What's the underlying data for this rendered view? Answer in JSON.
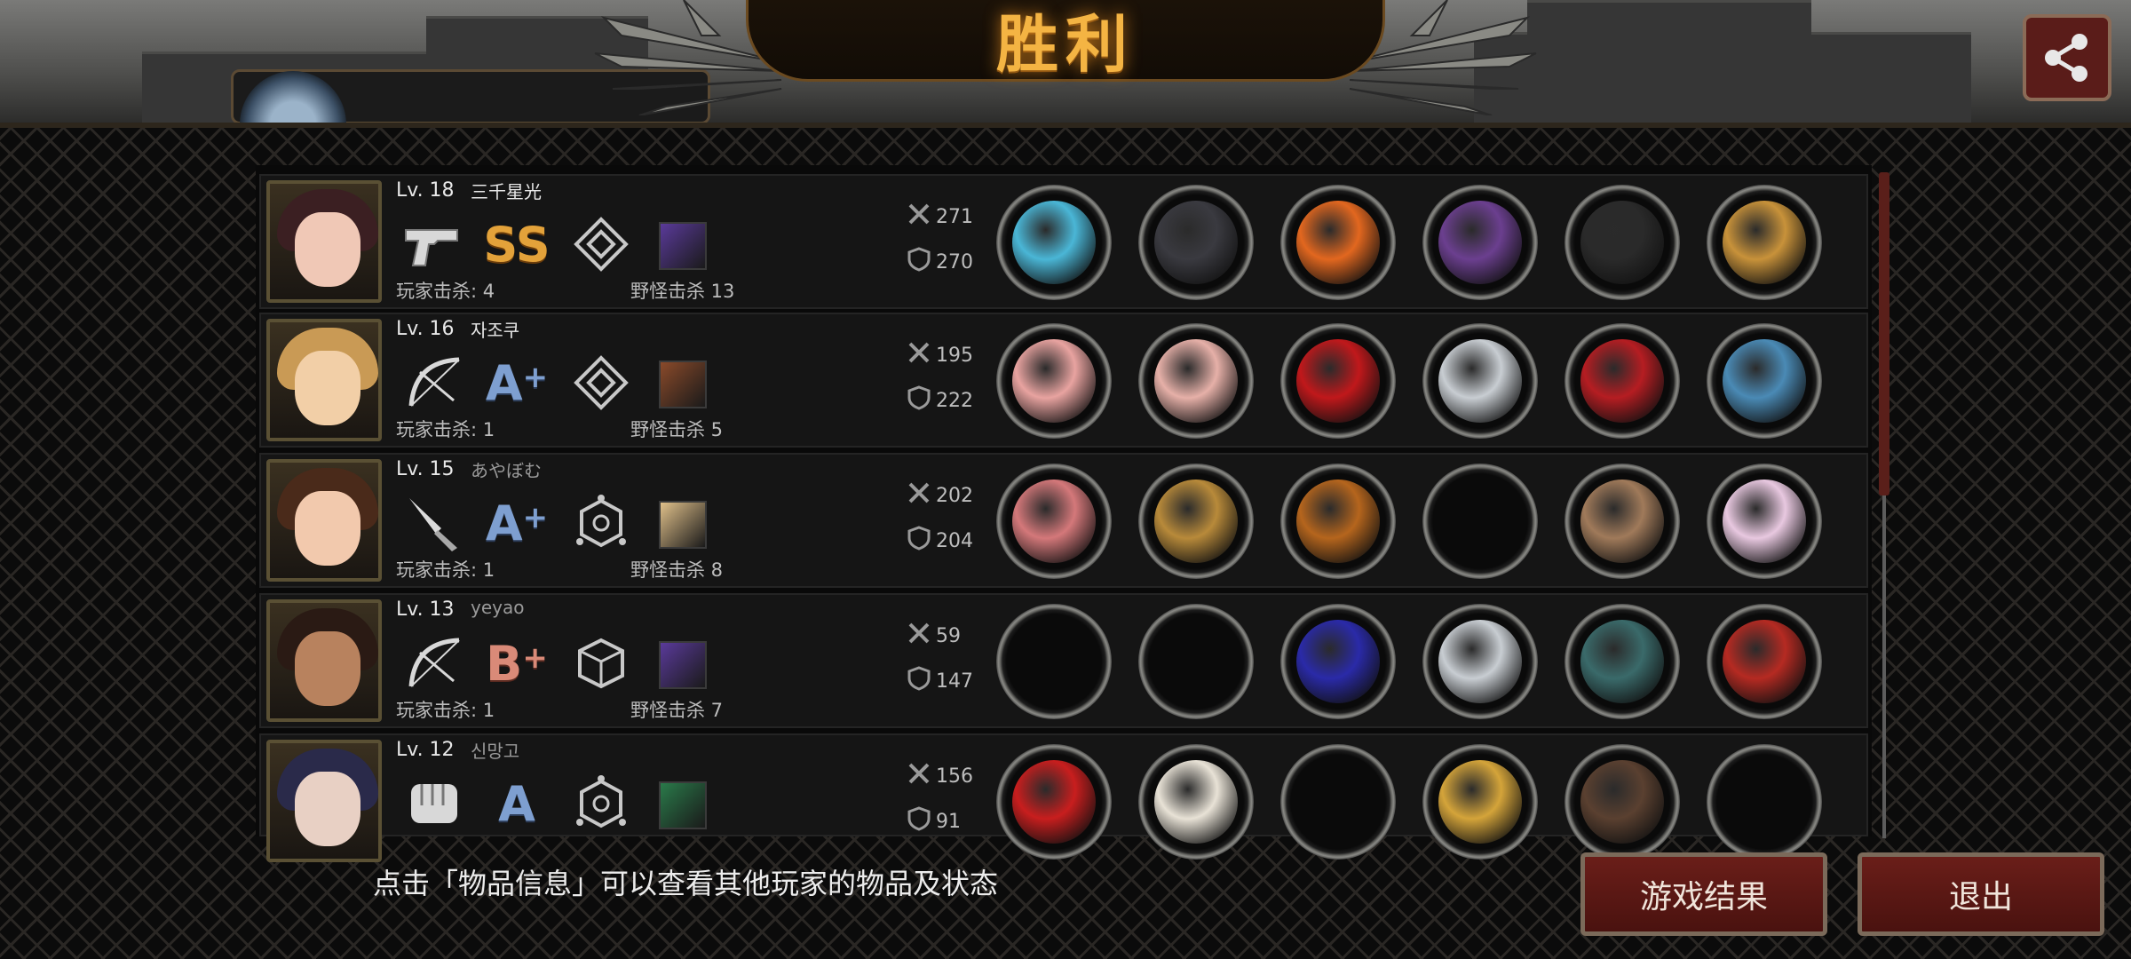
{
  "header": {
    "title": "胜利",
    "share_icon": "share-icon"
  },
  "players": [
    {
      "level": "Lv. 18",
      "name": "三千星光",
      "name_dim": false,
      "weapon": "pistol-icon",
      "grade": "SS",
      "grade_plus": "",
      "trait": "diamond-rank-icon",
      "skill_color": "#5a3a9a",
      "player_kills": "玩家击杀: 4",
      "monster_kills": "野怪击杀 13",
      "atk": "271",
      "def": "270",
      "hair": "#3b1f22",
      "skin": "#f0c8b6",
      "items": [
        "#4ab6d6",
        "#3a3a40",
        "#e2671f",
        "#6b3f8f",
        "#2a2a2a",
        "#c8923a"
      ]
    },
    {
      "level": "Lv. 16",
      "name": "자조쿠",
      "name_dim": false,
      "weapon": "bow-icon",
      "grade": "A",
      "grade_plus": "+",
      "trait": "diamond-rank-icon",
      "skill_color": "#8a4a2a",
      "player_kills": "玩家击杀: 1",
      "monster_kills": "野怪击杀 5",
      "atk": "195",
      "def": "222",
      "hair": "#c99a55",
      "skin": "#f2cfa7",
      "items": [
        "#e8a3a0",
        "#e6b0a8",
        "#c0181b",
        "#c8cdd2",
        "#b51d22",
        "#4a8ab5"
      ]
    },
    {
      "level": "Lv. 15",
      "name": "あやぼむ",
      "name_dim": true,
      "weapon": "knife-icon",
      "grade": "A",
      "grade_plus": "+",
      "trait": "hexagon-rank-icon",
      "skill_color": "#e0c08a",
      "player_kills": "玩家击杀: 1",
      "monster_kills": "野怪击杀 8",
      "atk": "202",
      "def": "204",
      "hair": "#4a2a1a",
      "skin": "#f2c9ad",
      "items": [
        "#d4787a",
        "#b88a3a",
        "#b5651d",
        "",
        "#a07a5a",
        "#e8c8e0"
      ]
    },
    {
      "level": "Lv. 13",
      "name": "yeyao",
      "name_dim": true,
      "weapon": "bow-icon",
      "grade": "B",
      "grade_plus": "+",
      "trait": "cube-rank-icon",
      "skill_color": "#5a3a9a",
      "player_kills": "玩家击杀: 1",
      "monster_kills": "野怪击杀 7",
      "atk": "59",
      "def": "147",
      "hair": "#2a1a14",
      "skin": "#b8825e",
      "items": [
        "",
        "",
        "#2a2aa8",
        "#c8cdd2",
        "#3a6a6a",
        "#b52a22"
      ]
    },
    {
      "level": "Lv. 12",
      "name": "신망고",
      "name_dim": true,
      "weapon": "fist-icon",
      "grade": "A",
      "grade_plus": "",
      "trait": "hexagon-rank-icon",
      "skill_color": "#2a7a4a",
      "player_kills": "",
      "monster_kills": "",
      "atk": "156",
      "def": "91",
      "hair": "#2a2a4a",
      "skin": "#e8d0c4",
      "items": [
        "#c81e1e",
        "#e8e2d6",
        "",
        "#d4a43a",
        "#5a4030",
        ""
      ]
    }
  ],
  "footer": {
    "hint": "点击「物品信息」可以查看其他玩家的物品及状态",
    "result_button": "游戏结果",
    "exit_button": "退出"
  }
}
